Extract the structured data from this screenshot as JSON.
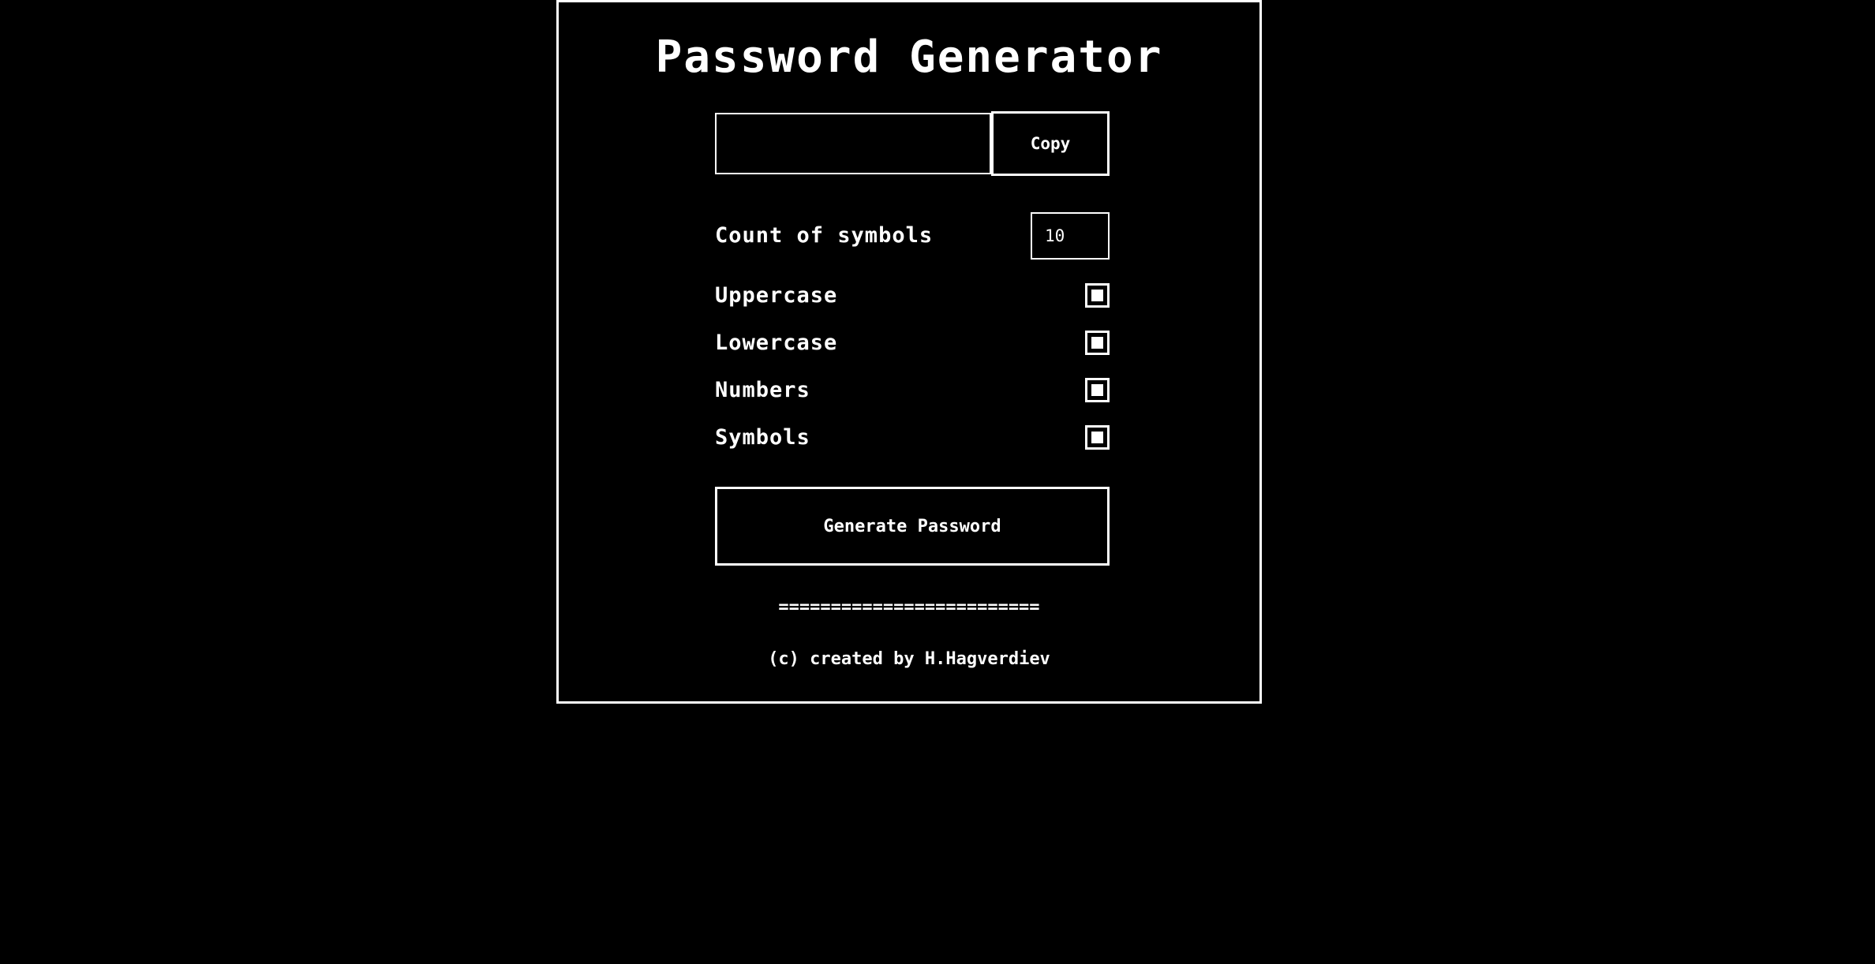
{
  "app": {
    "title": "Password Generator"
  },
  "output": {
    "value": "",
    "copy_label": "Copy"
  },
  "options": {
    "count": {
      "label": "Count of symbols",
      "value": "10"
    },
    "uppercase": {
      "label": "Uppercase",
      "checked": true
    },
    "lowercase": {
      "label": "Lowercase",
      "checked": true
    },
    "numbers": {
      "label": "Numbers",
      "checked": true
    },
    "symbols": {
      "label": "Symbols",
      "checked": true
    }
  },
  "actions": {
    "generate_label": "Generate Password"
  },
  "footer": {
    "divider": "=========================",
    "credit": "(c) created by H.Hagverdiev"
  },
  "colors": {
    "background": "#000000",
    "foreground": "#ffffff"
  }
}
